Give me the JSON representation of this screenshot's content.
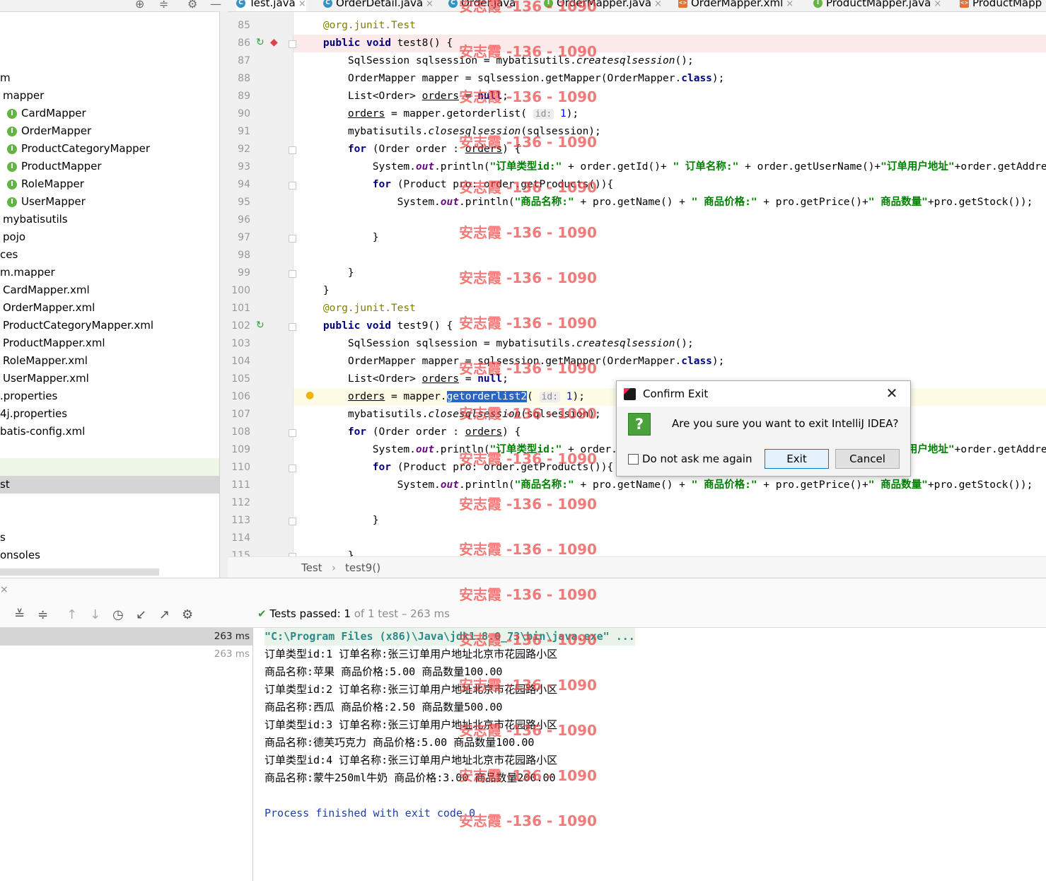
{
  "tabs": [
    {
      "label": "Test.java",
      "kind": "class",
      "active": true,
      "closable": true
    },
    {
      "label": "OrderDetail.java",
      "kind": "class",
      "closable": true
    },
    {
      "label": "Order.java",
      "kind": "class",
      "closable": false
    },
    {
      "label": "OrderMapper.java",
      "kind": "interface",
      "closable": true
    },
    {
      "label": "OrderMapper.xml",
      "kind": "xml",
      "closable": true
    },
    {
      "label": "ProductMapper.java",
      "kind": "interface",
      "closable": true
    },
    {
      "label": "ProductMapp",
      "kind": "xml",
      "closable": false
    }
  ],
  "project_tree": [
    {
      "label": "m",
      "indent": 0
    },
    {
      "label": "mapper",
      "indent": 4
    },
    {
      "label": "CardMapper",
      "indent": 10,
      "icon": "I"
    },
    {
      "label": "OrderMapper",
      "indent": 10,
      "icon": "I"
    },
    {
      "label": "ProductCategoryMapper",
      "indent": 10,
      "icon": "I"
    },
    {
      "label": "ProductMapper",
      "indent": 10,
      "icon": "I"
    },
    {
      "label": "RoleMapper",
      "indent": 10,
      "icon": "I"
    },
    {
      "label": "UserMapper",
      "indent": 10,
      "icon": "I"
    },
    {
      "label": "mybatisutils",
      "indent": 4
    },
    {
      "label": "pojo",
      "indent": 4
    },
    {
      "label": "ces",
      "indent": 0
    },
    {
      "label": "m.mapper",
      "indent": 0
    },
    {
      "label": "CardMapper.xml",
      "indent": 4
    },
    {
      "label": "OrderMapper.xml",
      "indent": 4
    },
    {
      "label": "ProductCategoryMapper.xml",
      "indent": 4
    },
    {
      "label": "ProductMapper.xml",
      "indent": 4
    },
    {
      "label": "RoleMapper.xml",
      "indent": 4
    },
    {
      "label": "UserMapper.xml",
      "indent": 4
    },
    {
      "label": ".properties",
      "indent": 0
    },
    {
      "label": "4j.properties",
      "indent": 0
    },
    {
      "label": "batis-config.xml",
      "indent": 0
    },
    {
      "label": "",
      "indent": 0
    },
    {
      "label": "",
      "indent": 0,
      "selected": "green"
    },
    {
      "label": "st",
      "indent": 0,
      "selected": "grey"
    },
    {
      "label": "",
      "indent": 0
    },
    {
      "label": "",
      "indent": 0
    },
    {
      "label": "s",
      "indent": 0
    },
    {
      "label": "onsoles",
      "indent": 0
    }
  ],
  "editor": {
    "lines": [
      {
        "n": "85",
        "html": "    <span class='ann'>@org.junit.Test</span>"
      },
      {
        "n": "86",
        "html": "    <span class='kw'>public void</span> test8() {",
        "hl": "red",
        "gutter": "run-breakpoint"
      },
      {
        "n": "87",
        "html": "        SqlSession sqlsession = mybatisutils.<span class='ital'>createsqlsession</span>();"
      },
      {
        "n": "88",
        "html": "        OrderMapper mapper = sqlsession.getMapper(OrderMapper.<span class='kw'>class</span>);"
      },
      {
        "n": "89",
        "html": "        List&lt;Order&gt; <span class='ul'>orders</span> = <span class='kw'>null</span>;"
      },
      {
        "n": "90",
        "html": "        <span class='ul'>orders</span> = mapper.getorderlist( <span class='hint'>id:</span> <span class='num'>1</span>);"
      },
      {
        "n": "91",
        "html": "        mybatisutils.<span class='ital'>closesqlsession</span>(sqlsession);"
      },
      {
        "n": "92",
        "html": "        <span class='kw'>for</span> (Order order : <span class='ul'>orders</span>) {"
      },
      {
        "n": "93",
        "html": "            System.<span class='fld'>out</span>.println(<span class='str'>\"订单类型id:\"</span> + order.getId()+ <span class='str'>\" 订单名称:\"</span> + order.getUserName()+<span class='str'>\"订单用户地址\"</span>+order.getAddress());"
      },
      {
        "n": "94",
        "html": "            <span class='kw'>for</span> (Product pro: order.getProducts()){"
      },
      {
        "n": "95",
        "html": "                System.<span class='fld'>out</span>.println(<span class='str'>\"商品名称:\"</span> + pro.getName() + <span class='str'>\" 商品价格:\"</span> + pro.getPrice()+<span class='str'>\" 商品数量\"</span>+pro.getStock());"
      },
      {
        "n": "96",
        "html": ""
      },
      {
        "n": "97",
        "html": "            }"
      },
      {
        "n": "98",
        "html": ""
      },
      {
        "n": "99",
        "html": "        }"
      },
      {
        "n": "100",
        "html": "    }"
      },
      {
        "n": "101",
        "html": "    <span class='ann'>@org.junit.Test</span>"
      },
      {
        "n": "102",
        "html": "    <span class='kw'>public void</span> test9() {",
        "gutter": "run"
      },
      {
        "n": "103",
        "html": "        SqlSession sqlsession = mybatisutils.<span class='ital'>createsqlsession</span>();"
      },
      {
        "n": "104",
        "html": "        OrderMapper mapper = sqlsession.getMapper(OrderMapper.<span class='kw'>class</span>);"
      },
      {
        "n": "105",
        "html": "        List&lt;Order&gt; <span class='ul'>orders</span> = <span class='kw'>null</span>;"
      },
      {
        "n": "106",
        "html": "        <span class='ul'>orders</span> = mapper.<span class='selword'>getorderlist2</span>( <span class='hint'>id:</span> <span class='num'>1</span>);",
        "hl": "caret",
        "gutter": "bulb"
      },
      {
        "n": "107",
        "html": "        mybatisutils.<span class='ital'>closesqlsession</span>(sqlsession);"
      },
      {
        "n": "108",
        "html": "        <span class='kw'>for</span> (Order order : <span class='ul'>orders</span>) {"
      },
      {
        "n": "109",
        "html": "            System.<span class='fld'>out</span>.println(<span class='str'>\"订单类型id:\"</span> + order.getId()+ <span class='str'>\" 订单名称:\"</span> + order.getUserName()+<span class='str'>\"订单用户地址\"</span>+order.getAddress());"
      },
      {
        "n": "110",
        "html": "            <span class='kw'>for</span> (Product pro: order.getProducts()){"
      },
      {
        "n": "111",
        "html": "                System.<span class='fld'>out</span>.println(<span class='str'>\"商品名称:\"</span> + pro.getName() + <span class='str'>\" 商品价格:\"</span> + pro.getPrice()+<span class='str'>\" 商品数量\"</span>+pro.getStock());"
      },
      {
        "n": "112",
        "html": ""
      },
      {
        "n": "113",
        "html": "            }"
      },
      {
        "n": "114",
        "html": ""
      },
      {
        "n": "115",
        "html": "        }"
      }
    ],
    "fold_rows": [
      1,
      7,
      9,
      12,
      14,
      17,
      23,
      25,
      28,
      30
    ]
  },
  "breadcrumb": {
    "class": "Test",
    "sep": "›",
    "method": "test9()"
  },
  "run": {
    "tests_passed_label": "Tests passed:",
    "tests_passed_count": "1",
    "tests_passed_rest": "of 1 test – 263 ms",
    "left_rows": [
      {
        "time": "263 ms",
        "selected": true
      },
      {
        "time": "263 ms",
        "selected": false
      }
    ],
    "console": [
      {
        "text": "\"C:\\Program Files (x86)\\Java\\jdk1.8.0_73\\bin\\java.exe\" ...",
        "kind": "cmd"
      },
      {
        "text": "订单类型id:1 订单名称:张三订单用户地址北京市花园路小区",
        "kind": "out"
      },
      {
        "text": "商品名称:苹果 商品价格:5.00 商品数量100.00",
        "kind": "out"
      },
      {
        "text": "订单类型id:2 订单名称:张三订单用户地址北京市花园路小区",
        "kind": "out"
      },
      {
        "text": "商品名称:西瓜 商品价格:2.50 商品数量500.00",
        "kind": "out"
      },
      {
        "text": "订单类型id:3 订单名称:张三订单用户地址北京市花园路小区",
        "kind": "out"
      },
      {
        "text": "商品名称:德芙巧克力 商品价格:5.00 商品数量100.00",
        "kind": "out"
      },
      {
        "text": "订单类型id:4 订单名称:张三订单用户地址北京市花园路小区",
        "kind": "out"
      },
      {
        "text": "商品名称:蒙牛250ml牛奶 商品价格:3.00 商品数量200.00",
        "kind": "out"
      },
      {
        "text": "",
        "kind": "out"
      },
      {
        "text": "Process finished with exit code 0",
        "kind": "exit"
      }
    ]
  },
  "dialog": {
    "title": "Confirm Exit",
    "message": "Are you sure you want to exit IntelliJ IDEA?",
    "checkbox_label": "Do not ask me again",
    "exit_label": "Exit",
    "cancel_label": "Cancel"
  },
  "watermark": {
    "text": "安志霞 -136 - 1090"
  },
  "colors": {
    "accent": "#4083c9",
    "keyword": "#000080",
    "string": "#008000",
    "annotation": "#808000",
    "watermark": "#f04646"
  }
}
